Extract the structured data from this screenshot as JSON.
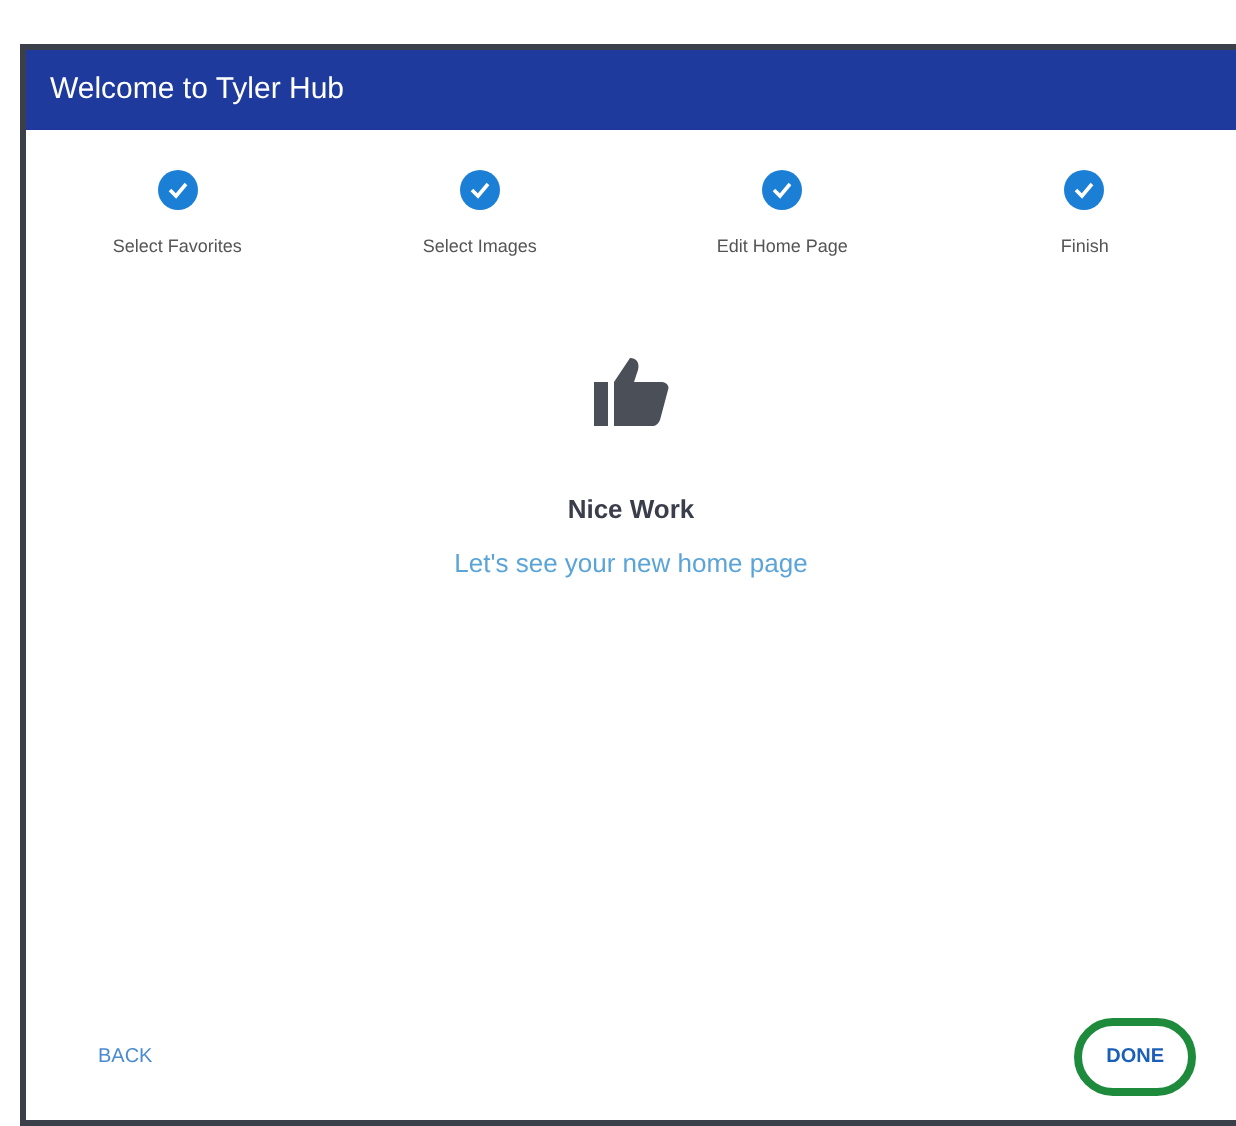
{
  "window": {
    "title": "Welcome to Tyler Hub"
  },
  "steps": [
    {
      "label": "Select Favorites",
      "completed": true
    },
    {
      "label": "Select Images",
      "completed": true
    },
    {
      "label": "Edit Home Page",
      "completed": true
    },
    {
      "label": "Finish",
      "completed": true
    }
  ],
  "message": {
    "title": "Nice Work",
    "subtitle": "Let's see your new home page"
  },
  "buttons": [
    {
      "label": "BACK",
      "highlighted": false
    },
    {
      "label": "DONE",
      "highlighted": true
    }
  ]
}
